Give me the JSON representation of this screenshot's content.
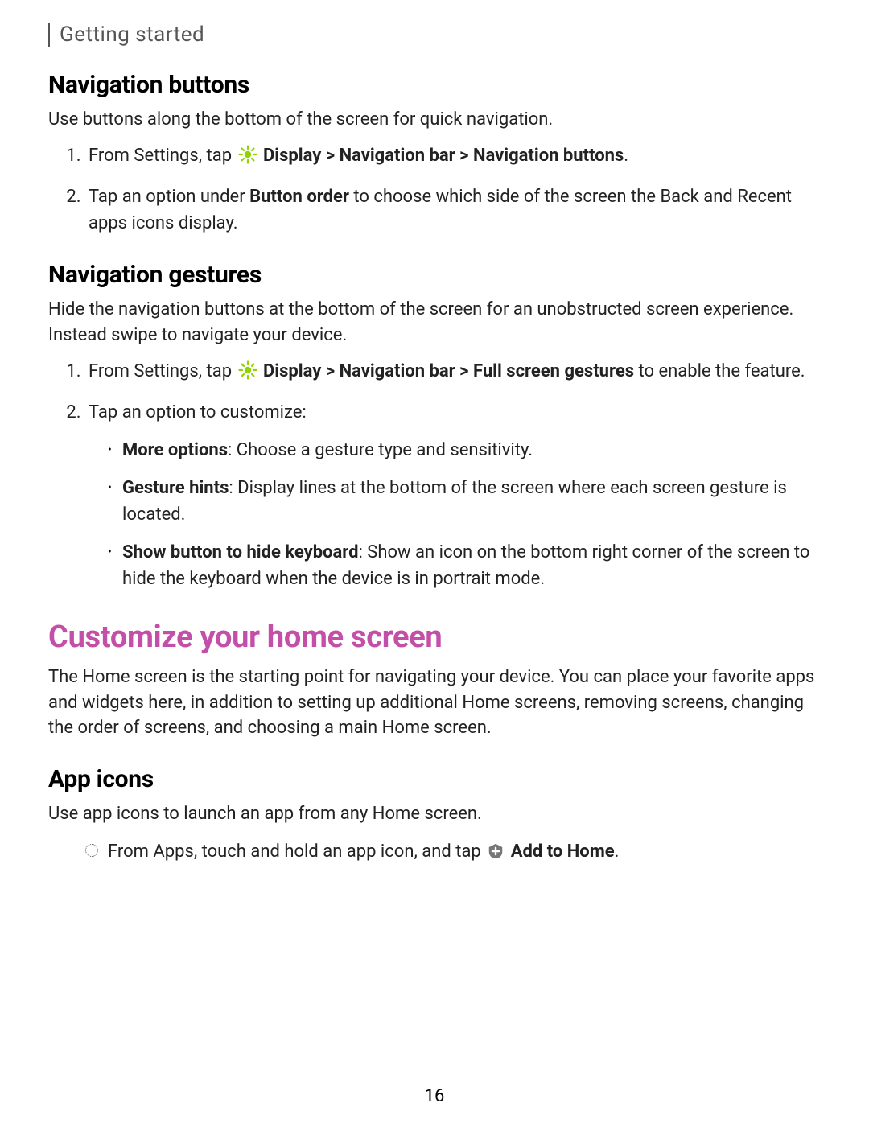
{
  "header": {
    "crumb": "Getting started"
  },
  "sections": {
    "navButtons": {
      "title": "Navigation buttons",
      "intro": "Use buttons along the bottom of the screen for quick navigation.",
      "steps": [
        {
          "prefix": "From Settings, tap ",
          "boldPath": "Display > Navigation bar > Navigation buttons",
          "suffix": "."
        },
        {
          "text": "Tap an option under ",
          "bold": "Button order",
          "text2": " to choose which side of the screen the Back and Recent apps icons display."
        }
      ]
    },
    "navGestures": {
      "title": "Navigation gestures",
      "intro": "Hide the navigation buttons at the bottom of the screen for an unobstructed screen experience. Instead swipe to navigate your device.",
      "steps": [
        {
          "prefix": "From Settings, tap ",
          "boldPath": "Display > Navigation bar > Full screen gestures",
          "suffix": " to enable the feature."
        },
        {
          "text": "Tap an option to customize:",
          "bullets": [
            {
              "bold": "More options",
              "rest": ": Choose a gesture type and sensitivity."
            },
            {
              "bold": "Gesture hints",
              "rest": ": Display lines at the bottom of the screen where each screen gesture is located."
            },
            {
              "bold": "Show button to hide keyboard",
              "rest": ": Show an icon on the bottom right corner of the screen to hide the keyboard when the device is in portrait mode."
            }
          ]
        }
      ]
    },
    "customize": {
      "title": "Customize your home screen",
      "intro": "The Home screen is the starting point for navigating your device. You can place your favorite apps and widgets here, in addition to setting up additional Home screens, removing screens, changing the order of screens, and choosing a main Home screen."
    },
    "appIcons": {
      "title": "App icons",
      "intro": "Use app icons to launch an app from any Home screen.",
      "bullet": {
        "prefix": "From Apps, touch and hold an app icon, and tap ",
        "bold": "Add to Home",
        "suffix": "."
      }
    }
  },
  "pageNumber": "16"
}
